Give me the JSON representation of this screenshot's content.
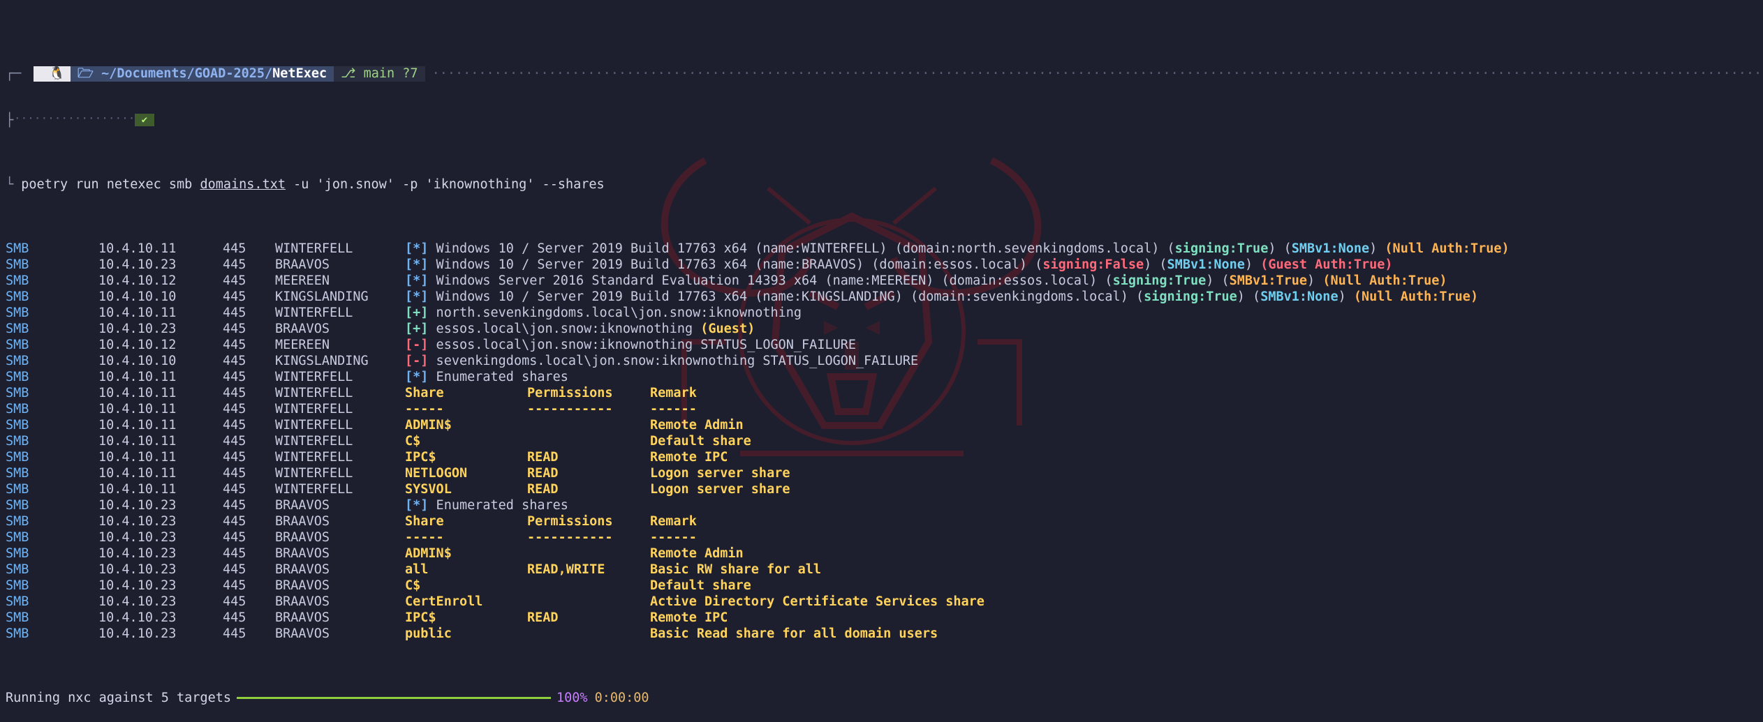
{
  "prompt": {
    "os_icon": "penguin-icon",
    "path_prefix": "~/Documents/GOAD-2025/",
    "cwd": "NetExec",
    "git_branch": "main ?7",
    "dots": "····································································································································································································································································································································································································",
    "check": "✔"
  },
  "command": {
    "base": "poetry run netexec smb ",
    "targets_file": "domains.txt",
    "args": " -u 'jon.snow' -p 'iknownothing' --shares"
  },
  "rows": [
    {
      "proto": "SMB",
      "ip": "10.4.10.11",
      "port": "445",
      "host": "WINTERFELL",
      "kind": "info",
      "segs": [
        [
          "star",
          "[*]"
        ],
        [
          "n",
          " Windows 10 / Server 2019 Build 17763 x64 (name:WINTERFELL) (domain:north.sevenkingdoms.local) ("
        ],
        [
          "gteal",
          "signing:True"
        ],
        [
          "n",
          ") ("
        ],
        [
          "cyan",
          "SMBv1:None"
        ],
        [
          "n",
          ") "
        ],
        [
          "orange",
          "(Null Auth:True)"
        ]
      ]
    },
    {
      "proto": "SMB",
      "ip": "10.4.10.23",
      "port": "445",
      "host": "BRAAVOS",
      "kind": "info",
      "segs": [
        [
          "star",
          "[*]"
        ],
        [
          "n",
          " Windows 10 / Server 2019 Build 17763 x64 (name:BRAAVOS) (domain:essos.local) ("
        ],
        [
          "red",
          "signing:False"
        ],
        [
          "n",
          ") ("
        ],
        [
          "cyan",
          "SMBv1:None"
        ],
        [
          "n",
          ") "
        ],
        [
          "red",
          "(Guest Auth:True)"
        ]
      ]
    },
    {
      "proto": "SMB",
      "ip": "10.4.10.12",
      "port": "445",
      "host": "MEEREEN",
      "kind": "info",
      "segs": [
        [
          "star",
          "[*]"
        ],
        [
          "n",
          " Windows Server 2016 Standard Evaluation 14393 x64 (name:MEEREEN) (domain:essos.local) ("
        ],
        [
          "gteal",
          "signing:True"
        ],
        [
          "n",
          ") ("
        ],
        [
          "orange",
          "SMBv1:True"
        ],
        [
          "n",
          ") "
        ],
        [
          "orange",
          "(Null Auth:True)"
        ]
      ]
    },
    {
      "proto": "SMB",
      "ip": "10.4.10.10",
      "port": "445",
      "host": "KINGSLANDING",
      "kind": "info",
      "segs": [
        [
          "star",
          "[*]"
        ],
        [
          "n",
          " Windows 10 / Server 2019 Build 17763 x64 (name:KINGSLANDING) (domain:sevenkingdoms.local) ("
        ],
        [
          "gteal",
          "signing:True"
        ],
        [
          "n",
          ") ("
        ],
        [
          "cyan",
          "SMBv1:None"
        ],
        [
          "n",
          ") "
        ],
        [
          "orange",
          "(Null Auth:True)"
        ]
      ]
    },
    {
      "proto": "SMB",
      "ip": "10.4.10.11",
      "port": "445",
      "host": "WINTERFELL",
      "kind": "info",
      "segs": [
        [
          "plus",
          "[+]"
        ],
        [
          "n",
          " north.sevenkingdoms.local\\jon.snow:iknownothing"
        ]
      ]
    },
    {
      "proto": "SMB",
      "ip": "10.4.10.23",
      "port": "445",
      "host": "BRAAVOS",
      "kind": "info",
      "segs": [
        [
          "plus",
          "[+]"
        ],
        [
          "n",
          " essos.local\\jon.snow:iknownothing "
        ],
        [
          "yellow",
          "(Guest)"
        ]
      ]
    },
    {
      "proto": "SMB",
      "ip": "10.4.10.12",
      "port": "445",
      "host": "MEEREEN",
      "kind": "info",
      "segs": [
        [
          "minus",
          "[-]"
        ],
        [
          "n",
          " essos.local\\jon.snow:iknownothing STATUS_LOGON_FAILURE"
        ]
      ]
    },
    {
      "proto": "SMB",
      "ip": "10.4.10.10",
      "port": "445",
      "host": "KINGSLANDING",
      "kind": "info",
      "segs": [
        [
          "minus",
          "[-]"
        ],
        [
          "n",
          " sevenkingdoms.local\\jon.snow:iknownothing STATUS_LOGON_FAILURE"
        ]
      ]
    },
    {
      "proto": "SMB",
      "ip": "10.4.10.11",
      "port": "445",
      "host": "WINTERFELL",
      "kind": "info",
      "segs": [
        [
          "star",
          "[*]"
        ],
        [
          "n",
          " Enumerated shares"
        ]
      ]
    },
    {
      "proto": "SMB",
      "ip": "10.4.10.11",
      "port": "445",
      "host": "WINTERFELL",
      "kind": "share",
      "share": "Share",
      "perm": "Permissions",
      "remark": "Remark"
    },
    {
      "proto": "SMB",
      "ip": "10.4.10.11",
      "port": "445",
      "host": "WINTERFELL",
      "kind": "share",
      "share": "-----",
      "perm": "-----------",
      "remark": "------"
    },
    {
      "proto": "SMB",
      "ip": "10.4.10.11",
      "port": "445",
      "host": "WINTERFELL",
      "kind": "share",
      "share": "ADMIN$",
      "perm": "",
      "remark": "Remote Admin"
    },
    {
      "proto": "SMB",
      "ip": "10.4.10.11",
      "port": "445",
      "host": "WINTERFELL",
      "kind": "share",
      "share": "C$",
      "perm": "",
      "remark": "Default share"
    },
    {
      "proto": "SMB",
      "ip": "10.4.10.11",
      "port": "445",
      "host": "WINTERFELL",
      "kind": "share",
      "share": "IPC$",
      "perm": "READ",
      "remark": "Remote IPC"
    },
    {
      "proto": "SMB",
      "ip": "10.4.10.11",
      "port": "445",
      "host": "WINTERFELL",
      "kind": "share",
      "share": "NETLOGON",
      "perm": "READ",
      "remark": "Logon server share"
    },
    {
      "proto": "SMB",
      "ip": "10.4.10.11",
      "port": "445",
      "host": "WINTERFELL",
      "kind": "share",
      "share": "SYSVOL",
      "perm": "READ",
      "remark": "Logon server share"
    },
    {
      "proto": "SMB",
      "ip": "10.4.10.23",
      "port": "445",
      "host": "BRAAVOS",
      "kind": "info",
      "segs": [
        [
          "star",
          "[*]"
        ],
        [
          "n",
          " Enumerated shares"
        ]
      ]
    },
    {
      "proto": "SMB",
      "ip": "10.4.10.23",
      "port": "445",
      "host": "BRAAVOS",
      "kind": "share",
      "share": "Share",
      "perm": "Permissions",
      "remark": "Remark"
    },
    {
      "proto": "SMB",
      "ip": "10.4.10.23",
      "port": "445",
      "host": "BRAAVOS",
      "kind": "share",
      "share": "-----",
      "perm": "-----------",
      "remark": "------"
    },
    {
      "proto": "SMB",
      "ip": "10.4.10.23",
      "port": "445",
      "host": "BRAAVOS",
      "kind": "share",
      "share": "ADMIN$",
      "perm": "",
      "remark": "Remote Admin"
    },
    {
      "proto": "SMB",
      "ip": "10.4.10.23",
      "port": "445",
      "host": "BRAAVOS",
      "kind": "share",
      "share": "all",
      "perm": "READ,WRITE",
      "remark": "Basic RW share for all"
    },
    {
      "proto": "SMB",
      "ip": "10.4.10.23",
      "port": "445",
      "host": "BRAAVOS",
      "kind": "share",
      "share": "C$",
      "perm": "",
      "remark": "Default share"
    },
    {
      "proto": "SMB",
      "ip": "10.4.10.23",
      "port": "445",
      "host": "BRAAVOS",
      "kind": "share",
      "share": "CertEnroll",
      "perm": "",
      "remark": "Active Directory Certificate Services share"
    },
    {
      "proto": "SMB",
      "ip": "10.4.10.23",
      "port": "445",
      "host": "BRAAVOS",
      "kind": "share",
      "share": "IPC$",
      "perm": "READ",
      "remark": "Remote IPC"
    },
    {
      "proto": "SMB",
      "ip": "10.4.10.23",
      "port": "445",
      "host": "BRAAVOS",
      "kind": "share",
      "share": "public",
      "perm": "",
      "remark": "Basic Read share for all domain users"
    }
  ],
  "progress": {
    "label": "Running nxc against 5 targets",
    "percent_text": "100%",
    "percent": 100,
    "elapsed": "0:00:00"
  },
  "colors": {
    "background": "#1e1f2e",
    "watermark": "#7a1f2a",
    "progress_fill": "#8fcf3c"
  }
}
